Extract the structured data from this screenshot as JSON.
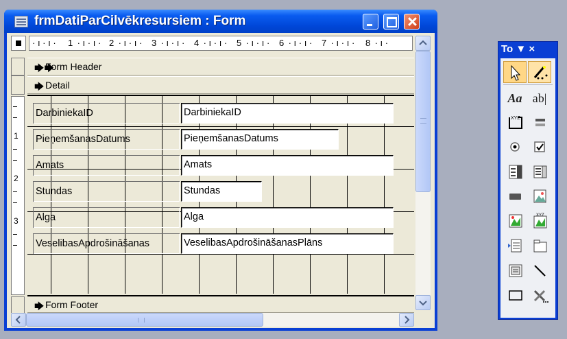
{
  "window": {
    "title": "frmDatiParCilvēkresursiem : Form"
  },
  "ruler": {
    "marks": [
      "1",
      "2",
      "3",
      "4",
      "5",
      "6",
      "7",
      "8"
    ],
    "vertical_marks": [
      "1",
      "2",
      "3"
    ]
  },
  "sections": {
    "form_header": "Form Header",
    "detail": "Detail",
    "form_footer": "Form Footer"
  },
  "fields": [
    {
      "label": "DarbiniekaID",
      "control": "DarbiniekaID"
    },
    {
      "label": "PieņemšanasDatums",
      "control": "PieņemšanasDatums"
    },
    {
      "label": "Amats",
      "control": "Amats"
    },
    {
      "label": "Stundas",
      "control": "Stundas"
    },
    {
      "label": "Alga",
      "control": "Alga"
    },
    {
      "label": "VeselibasApdrošināšanas",
      "control": "VeselibasApdrošināšanasPlāns"
    }
  ],
  "toolbox": {
    "title": "To ▼ ×",
    "tools": [
      "select-objects-icon",
      "control-wizards-icon",
      "label-icon",
      "text-box-icon",
      "option-group-icon",
      "toggle-button-icon",
      "option-button-icon",
      "check-box-icon",
      "combo-box-icon",
      "list-box-icon",
      "command-button-icon",
      "image-icon",
      "unbound-object-frame-icon",
      "bound-object-frame-icon",
      "page-break-icon",
      "tab-control-icon",
      "subform-icon",
      "line-icon",
      "rectangle-icon",
      "more-controls-icon"
    ],
    "label_glyph": "Aa",
    "textbox_glyph": "ab|",
    "xyz_glyph": "XYZ"
  },
  "colors": {
    "titlebar": "#0a5cf0",
    "window_bg": "#ece9d8",
    "selected_tool": "#ffd786"
  }
}
